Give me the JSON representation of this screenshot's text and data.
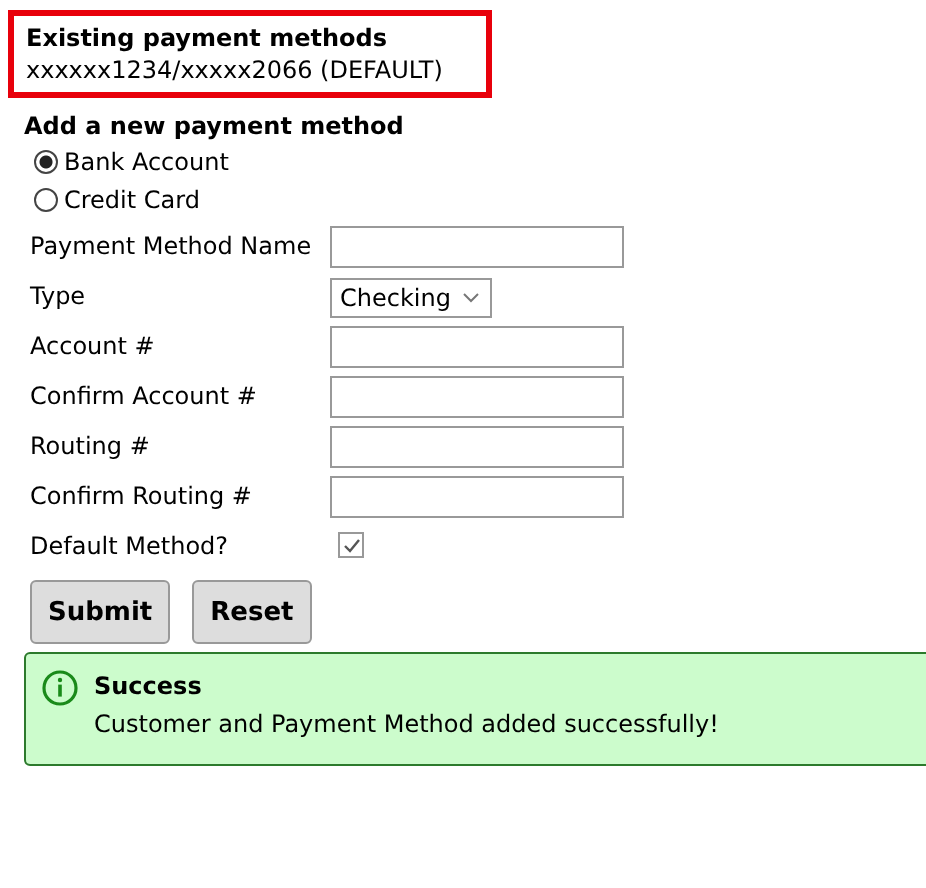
{
  "existing": {
    "title": "Existing payment methods",
    "value": "xxxxxx1234/xxxxx2066 (DEFAULT)"
  },
  "add": {
    "title": "Add a new payment method",
    "options": [
      {
        "label": "Bank Account",
        "selected": true
      },
      {
        "label": "Credit Card",
        "selected": false
      }
    ],
    "fields": [
      {
        "kind": "text",
        "label": "Payment Method Name"
      },
      {
        "kind": "select",
        "label": "Type",
        "value": "Checking"
      },
      {
        "kind": "text",
        "label": "Account #"
      },
      {
        "kind": "text",
        "label": "Confirm Account #"
      },
      {
        "kind": "text",
        "label": "Routing #"
      },
      {
        "kind": "text",
        "label": "Confirm Routing #"
      },
      {
        "kind": "checkbox",
        "label": "Default Method?",
        "checked": true
      }
    ],
    "buttons": [
      "Submit",
      "Reset"
    ]
  },
  "alert": {
    "title": "Success",
    "message": "Customer and Payment Method added successfully!"
  }
}
